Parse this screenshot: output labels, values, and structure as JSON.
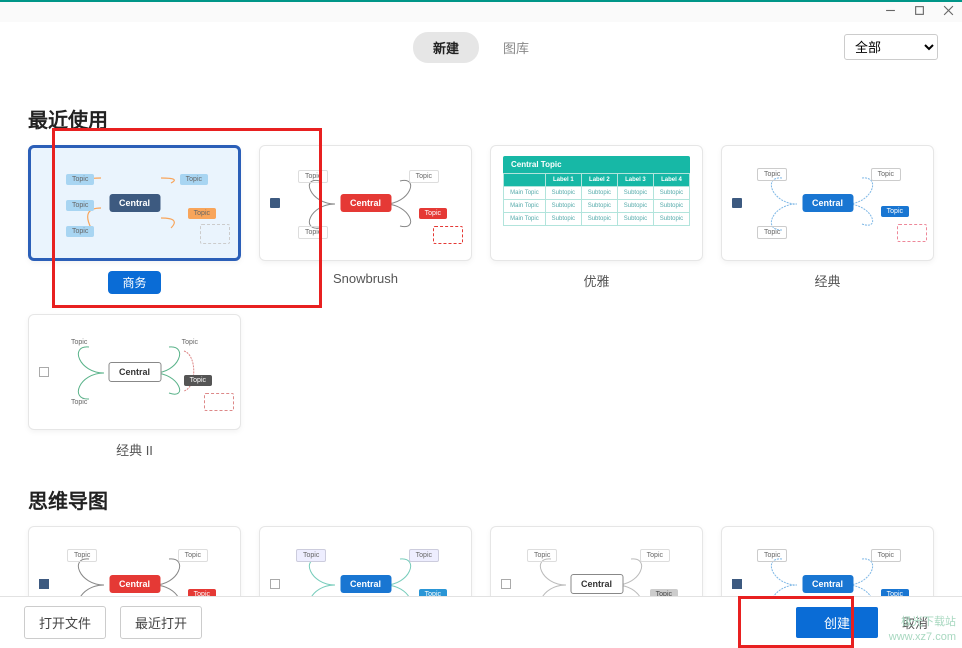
{
  "window": {
    "minimize_icon": "minimize",
    "maximize_icon": "maximize",
    "close_icon": "close"
  },
  "header": {
    "tabs": [
      {
        "label": "新建",
        "active": true
      },
      {
        "label": "图库",
        "active": false
      }
    ],
    "filter": {
      "value": "全部"
    }
  },
  "sections": {
    "recent": {
      "title": "最近使用",
      "templates": [
        {
          "label": "商务",
          "selected": true,
          "style": "business"
        },
        {
          "label": "Snowbrush",
          "style": "snowbrush"
        },
        {
          "label": "优雅",
          "style": "elegant"
        },
        {
          "label": "经典",
          "style": "classic"
        },
        {
          "label": "经典 II",
          "style": "classic2"
        }
      ]
    },
    "mindmap": {
      "title": "思维导图",
      "templates": [
        {
          "label": "",
          "style": "snowbrush"
        },
        {
          "label": "",
          "style": "blue"
        },
        {
          "label": "",
          "style": "mono"
        },
        {
          "label": "",
          "style": "classic"
        }
      ]
    }
  },
  "mindmap_preview": {
    "central": "Central",
    "topic": "Topic",
    "central_topic": "Central Topic",
    "main_topic": "Main Topic",
    "subtopic": "Subtopic",
    "labels": [
      "Label 1",
      "Label 2",
      "Label 3",
      "Label 4"
    ]
  },
  "footer": {
    "open_file": "打开文件",
    "recent_open": "最近打开",
    "create": "创建",
    "cancel": "取消"
  },
  "watermark": {
    "line1": "极光下载站",
    "line2": "www.xz7.com"
  }
}
